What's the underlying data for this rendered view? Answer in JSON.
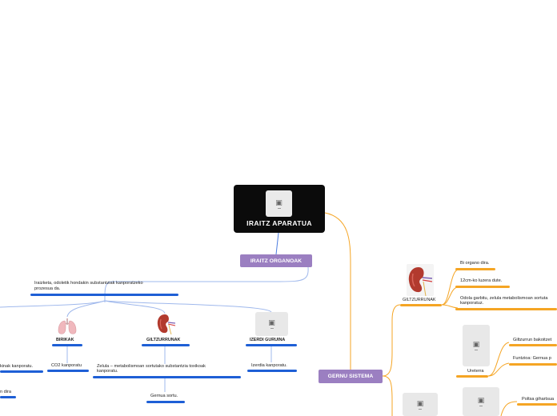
{
  "central": {
    "title": "IRAITZ APARATUA",
    "icon": "image-placeholder-icon"
  },
  "left_branch": {
    "title": "IRAITZ ORGANOAK",
    "description_line1": "Iraizketa, odoletik hondakin substantziak kanporatzeko",
    "description_line2": "prozesua da.",
    "organs": [
      {
        "name": "BIRIKAK",
        "children": [
          "CO2 kanporatu"
        ]
      },
      {
        "name": "GILTZURRUNAK",
        "children": [
          "Zelula – metabolismoan sortutako substantzia toxikoak",
          "kanporatu."
        ],
        "sub": "Gernua sortu."
      },
      {
        "name": "IZERDI GURUINA",
        "children": [
          "Izerdia kanporatu."
        ]
      }
    ],
    "offscreen_left_1": "kinak kanporatu.",
    "offscreen_left_2": "n dira"
  },
  "right_branch": {
    "title": "GERNU SISTEMA",
    "giltzurrunak": {
      "name": "GILTZURRUNAK",
      "facts": [
        "Bi organo dira.",
        "12cm-ko luzera dute.",
        "Odola garbitu, zelula metabolismoan sortuta",
        "kanporatuz."
      ]
    },
    "ureterra": {
      "name": "Ureterra",
      "facts": [
        "Giltzurrun bakoitzet",
        "Funtzioa: Gernua p"
      ]
    },
    "poltsa": {
      "fact": "Poltsa gihartsua"
    }
  },
  "colors": {
    "blue_line": "#1e5fd6",
    "orange_line": "#f5a524",
    "purple_pill": "#9b7fc1",
    "central_bg": "#0b0b0b"
  }
}
